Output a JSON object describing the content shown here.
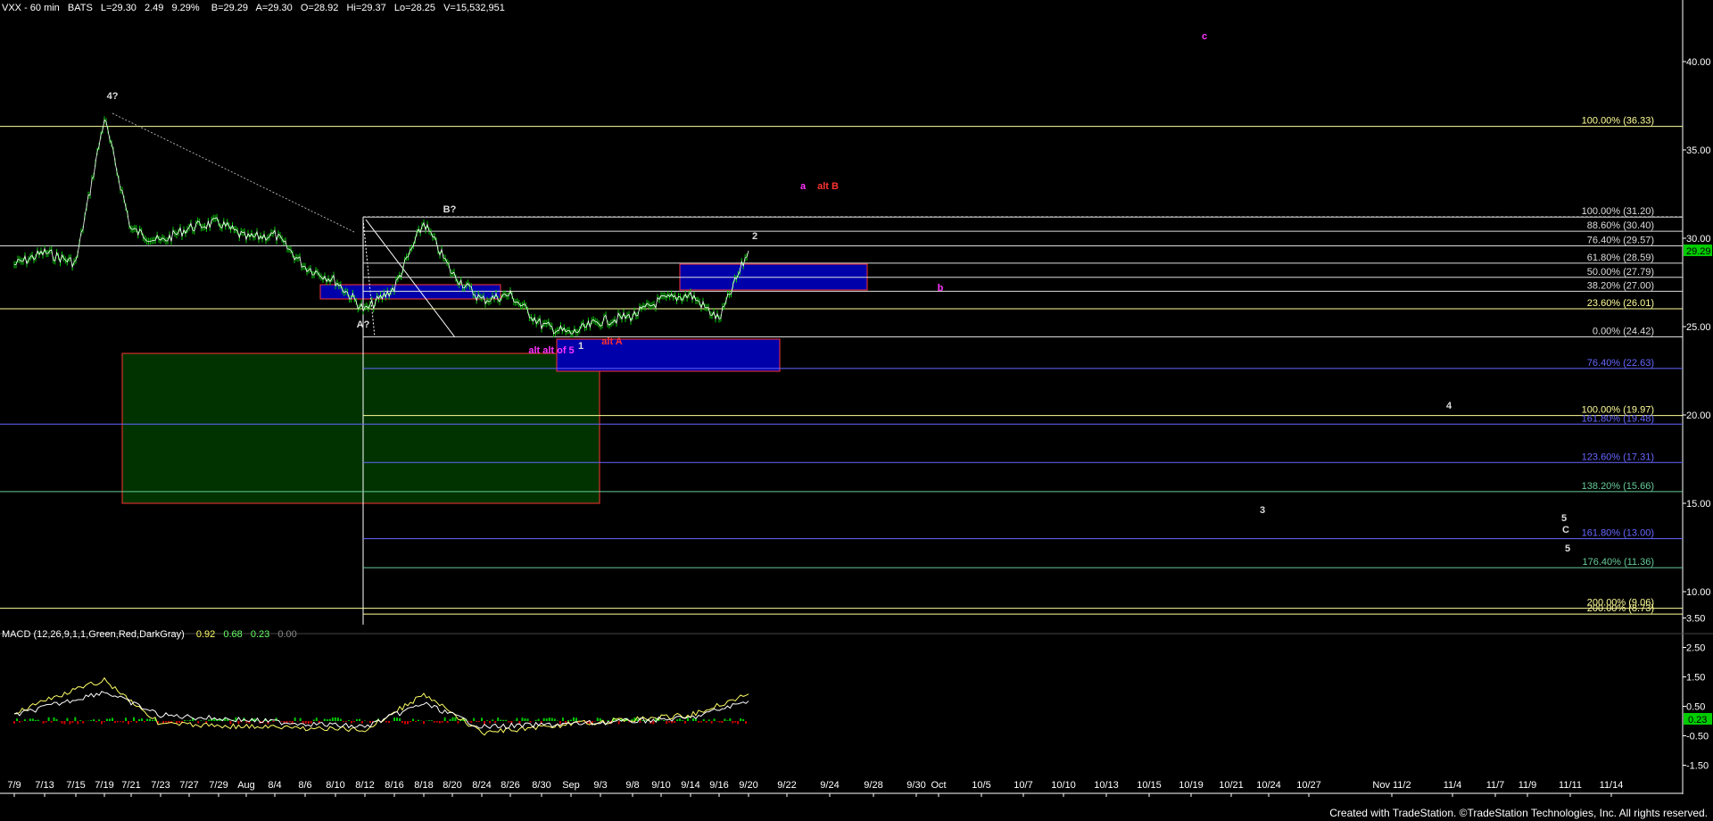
{
  "header": {
    "symbol": "VXX - 60 min",
    "exchange": "BATS",
    "last": "L=29.30",
    "change": "2.49",
    "change_pct": "9.29%",
    "bid": "B=29.29",
    "ask": "A=29.30",
    "open": "O=28.92",
    "high": "Hi=29.37",
    "low": "Lo=28.25",
    "volume": "V=15,532,951"
  },
  "macd_header": {
    "label": "MACD (12,26,9,1,1,Green,Red,DarkGray)",
    "v1": "0.92",
    "v2": "0.68",
    "v3": "0.23",
    "v4": "0.00"
  },
  "footer": "Created with TradeStation. ©TradeStation Technologies, Inc. All rights reserved.",
  "last_price_tag": "29.29",
  "macd_tag": "0.23",
  "colors": {
    "background": "#000000",
    "price": "#00ff00",
    "fib_yellow": "#ffff99",
    "fib_blue": "#6666ff",
    "fib_green": "#66cc99",
    "blue_box": "#0000aa",
    "green_box": "#003300",
    "box_border": "#ff3333",
    "magenta": "#ff33ff",
    "red": "#ff3333"
  },
  "chart_data": [
    {
      "type": "line",
      "title": "VXX - 60 min",
      "ylim": [
        8.0,
        43.0
      ],
      "y_ticks": [
        "40.00",
        "35.00",
        "30.00",
        "25.00",
        "20.00",
        "15.00",
        "10.00"
      ],
      "x_ticks": [
        "7/9",
        "7/13",
        "7/15",
        "7/19",
        "7/21",
        "7/23",
        "7/27",
        "7/29",
        "Aug",
        "8/4",
        "8/6",
        "8/10",
        "8/12",
        "8/16",
        "8/18",
        "8/20",
        "8/24",
        "8/26",
        "8/30",
        "Sep",
        "9/3",
        "9/8",
        "9/10",
        "9/14",
        "9/16",
        "9/20",
        "9/22",
        "9/24",
        "9/28",
        "9/30",
        "Oct",
        "10/5",
        "10/7",
        "10/10",
        "10/13",
        "10/15",
        "10/19",
        "10/21",
        "10/24",
        "10/27",
        "Nov 11/2",
        "11/4",
        "11/7",
        "11/9",
        "11/11",
        "11/14"
      ],
      "series": [
        {
          "values_by_tick": [
            {
              "x": "7/9",
              "y": 28.5
            },
            {
              "x": "7/13",
              "y": 29.2
            },
            {
              "x": "7/15",
              "y": 28.6
            },
            {
              "x": "7/19",
              "y": 36.8
            },
            {
              "x": "7/21",
              "y": 30.5
            },
            {
              "x": "7/23",
              "y": 29.8
            },
            {
              "x": "7/27",
              "y": 30.6
            },
            {
              "x": "7/29",
              "y": 30.9
            },
            {
              "x": "Aug",
              "y": 30.0
            },
            {
              "x": "8/4",
              "y": 30.2
            },
            {
              "x": "8/6",
              "y": 28.4
            },
            {
              "x": "8/10",
              "y": 27.6
            },
            {
              "x": "8/12",
              "y": 25.9
            },
            {
              "x": "8/16",
              "y": 27.2
            },
            {
              "x": "8/18",
              "y": 30.9
            },
            {
              "x": "8/20",
              "y": 28.0
            },
            {
              "x": "8/24",
              "y": 26.5
            },
            {
              "x": "8/26",
              "y": 26.8
            },
            {
              "x": "8/30",
              "y": 25.1
            },
            {
              "x": "Sep",
              "y": 24.6
            },
            {
              "x": "9/3",
              "y": 25.3
            },
            {
              "x": "9/8",
              "y": 25.6
            },
            {
              "x": "9/10",
              "y": 26.5
            },
            {
              "x": "9/14",
              "y": 26.8
            },
            {
              "x": "9/16",
              "y": 25.4
            },
            {
              "x": "9/20",
              "y": 29.3
            }
          ]
        }
      ],
      "fib_levels": [
        {
          "label": "100.00% (36.33)",
          "value": 36.33,
          "color": "yellow"
        },
        {
          "label": "100.00% (31.20)",
          "value": 31.2,
          "color": "white"
        },
        {
          "label": "88.60% (30.40)",
          "value": 30.4,
          "color": "white"
        },
        {
          "label": "76.40% (29.57)",
          "value": 29.57,
          "color": "white"
        },
        {
          "label": "61.80% (28.59)",
          "value": 28.59,
          "color": "white"
        },
        {
          "label": "50.00% (27.79)",
          "value": 27.79,
          "color": "white"
        },
        {
          "label": "38.20% (27.00)",
          "value": 27.0,
          "color": "white"
        },
        {
          "label": "23.60% (26.01)",
          "value": 26.01,
          "color": "yellow"
        },
        {
          "label": "0.00% (24.42)",
          "value": 24.42,
          "color": "white"
        },
        {
          "label": "76.40% (22.63)",
          "value": 22.63,
          "color": "blue"
        },
        {
          "label": "100.00% (19.97)",
          "value": 19.97,
          "color": "yellow"
        },
        {
          "label": "161.80% (19.48)",
          "value": 19.48,
          "color": "blue"
        },
        {
          "label": "123.60% (17.31)",
          "value": 17.31,
          "color": "blue"
        },
        {
          "label": "138.20% (15.66)",
          "value": 15.66,
          "color": "green"
        },
        {
          "label": "161.80% (13.00)",
          "value": 13.0,
          "color": "blue"
        },
        {
          "label": "176.40% (11.36)",
          "value": 11.36,
          "color": "green"
        },
        {
          "label": "200.00% (9.06)",
          "value": 9.06,
          "color": "yellow"
        },
        {
          "label": "200.00% (8.73)",
          "value": 8.73,
          "color": "yellow"
        }
      ],
      "wave_labels": [
        {
          "text": "4?",
          "color": "white"
        },
        {
          "text": "B?",
          "color": "white"
        },
        {
          "text": "A?",
          "color": "white"
        },
        {
          "text": "a",
          "color": "magenta"
        },
        {
          "text": "alt B",
          "color": "red"
        },
        {
          "text": "2",
          "color": "white"
        },
        {
          "text": "b",
          "color": "magenta"
        },
        {
          "text": "c",
          "color": "magenta"
        },
        {
          "text": "alt alt of 5",
          "color": "magenta"
        },
        {
          "text": "1",
          "color": "white"
        },
        {
          "text": "alt A",
          "color": "red"
        },
        {
          "text": "4",
          "color": "white"
        },
        {
          "text": "3",
          "color": "white"
        },
        {
          "text": "5",
          "color": "white"
        },
        {
          "text": "C",
          "color": "white"
        },
        {
          "text": "5",
          "color": "white"
        }
      ]
    },
    {
      "type": "line",
      "title": "MACD (12,26,9,1,1,Green,Red,DarkGray)",
      "ylim": [
        -2.5,
        4.0
      ],
      "y_ticks": [
        "3.50",
        "2.50",
        "1.50",
        "0.50",
        "-0.50",
        "-1.50"
      ],
      "series": [
        {
          "name": "MACD",
          "values_by_tick": [
            {
              "x": "7/9",
              "y": 0.3
            },
            {
              "x": "7/19",
              "y": 1.4
            },
            {
              "x": "7/23",
              "y": -0.1
            },
            {
              "x": "8/12",
              "y": -0.3
            },
            {
              "x": "8/18",
              "y": 0.9
            },
            {
              "x": "8/24",
              "y": -0.4
            },
            {
              "x": "Sep",
              "y": -0.1
            },
            {
              "x": "9/14",
              "y": 0.2
            },
            {
              "x": "9/20",
              "y": 0.92
            }
          ]
        },
        {
          "name": "Signal",
          "values_by_tick": [
            {
              "x": "7/9",
              "y": 0.2
            },
            {
              "x": "7/19",
              "y": 1.0
            },
            {
              "x": "7/23",
              "y": 0.2
            },
            {
              "x": "8/12",
              "y": -0.2
            },
            {
              "x": "8/18",
              "y": 0.6
            },
            {
              "x": "8/24",
              "y": -0.2
            },
            {
              "x": "Sep",
              "y": -0.1
            },
            {
              "x": "9/14",
              "y": 0.1
            },
            {
              "x": "9/20",
              "y": 0.68
            }
          ]
        }
      ]
    }
  ]
}
